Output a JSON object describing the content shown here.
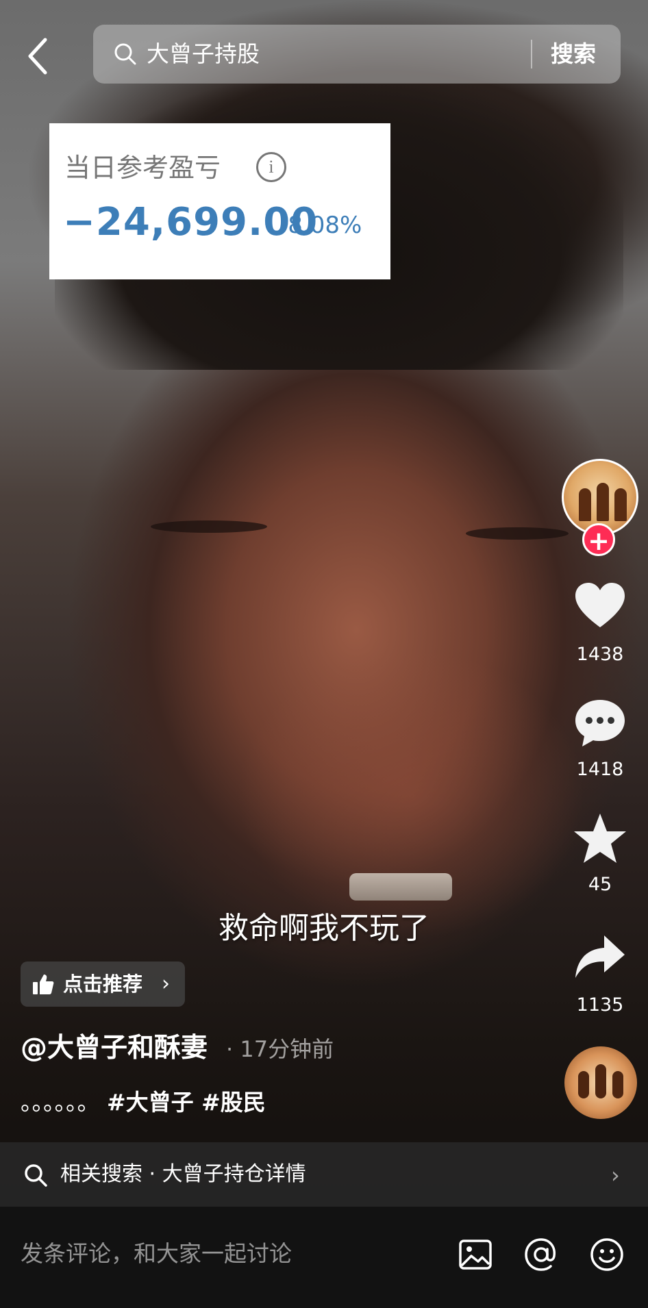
{
  "search": {
    "query": "大曾子持股",
    "button_label": "搜索"
  },
  "profit_card": {
    "label": "当日参考盈亏",
    "info_symbol": "i",
    "value": "−24,699.00",
    "percent": "-8.08%",
    "value_color": "#3d7eb8"
  },
  "sidebar": {
    "follow_symbol": "+",
    "like_count": "1438",
    "comment_count": "1418",
    "favorite_count": "45",
    "share_count": "1135"
  },
  "subtitle": "救命啊我不玩了",
  "recommend": {
    "label": "点击推荐",
    "chevron": "›"
  },
  "post": {
    "author": "@大曾子和酥妻",
    "time_ago": "· 17分钟前",
    "caption_dots": "。。。。。。",
    "hashtags": "#大曾子 #股民"
  },
  "related_search": {
    "text": "相关搜索 · 大曾子持仓详情",
    "chevron": "›"
  },
  "comment": {
    "placeholder": "发条评论，和大家一起讨论"
  },
  "colors": {
    "accent_red": "#fe2c55",
    "loss_blue": "#3d7eb8"
  },
  "icons": [
    "back-icon",
    "search-icon",
    "info-icon",
    "heart-icon",
    "comment-icon",
    "star-icon",
    "share-icon",
    "thumbs-up-icon",
    "image-icon",
    "at-icon",
    "emoji-icon"
  ]
}
